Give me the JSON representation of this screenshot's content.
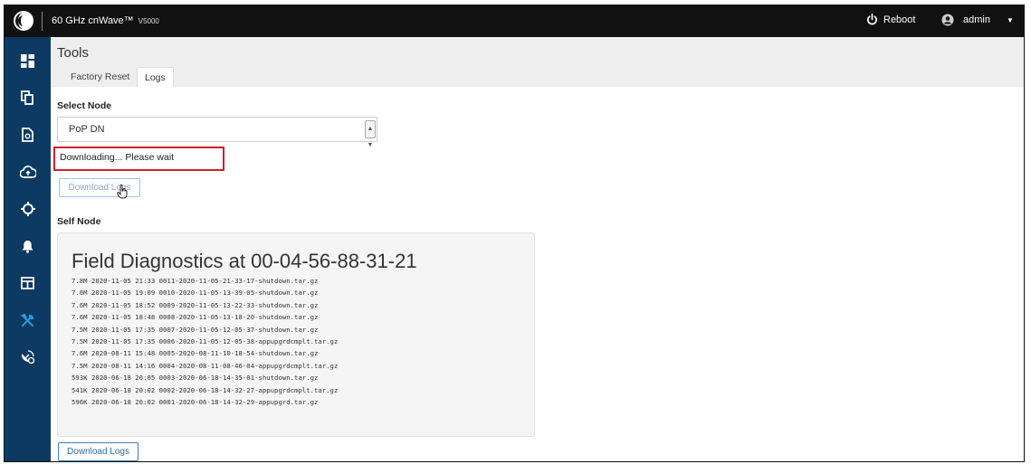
{
  "topbar": {
    "app_title": "60 GHz cnWave™",
    "model": "V5000",
    "reboot_label": "Reboot",
    "user_label": "admin",
    "icons": {
      "logo": "cambium-logo-icon",
      "reboot": "power-icon",
      "user": "user-circle-icon",
      "caret": "caret-down-icon"
    }
  },
  "sidebar": {
    "items": [
      {
        "icon": "dashboard-icon",
        "active": false
      },
      {
        "icon": "copy-icon",
        "active": false
      },
      {
        "icon": "document-gear-icon",
        "active": false
      },
      {
        "icon": "cloud-upload-icon",
        "active": false
      },
      {
        "icon": "crosshair-icon",
        "active": false
      },
      {
        "icon": "bell-icon",
        "active": false
      },
      {
        "icon": "layout-icon",
        "active": false
      },
      {
        "icon": "tools-icon",
        "active": true
      },
      {
        "icon": "satellite-dish-icon",
        "active": false
      }
    ],
    "active_color": "#2d9cdb",
    "icon_color": "#ffffff"
  },
  "page": {
    "title": "Tools",
    "tabs": [
      {
        "label": "Factory Reset",
        "active": false
      },
      {
        "label": "Logs",
        "active": true
      }
    ]
  },
  "logs": {
    "select_label": "Select Node",
    "selected_node": "PoP DN",
    "status_text": "Downloading... Please wait",
    "download_button_label": "Download Logs",
    "self_node_label": "Self Node",
    "diagnostics_title": "Field Diagnostics at 00-04-56-88-31-21",
    "files": [
      "7.8M 2020-11-05 21:33 0011-2020-11-05-21-33-17-shutdown.tar.gz",
      "7.6M 2020-11-05 19:09 0010-2020-11-05-13-39-05-shutdown.tar.gz",
      "7.6M 2020-11-05 18:52 0009-2020-11-05-13-22-33-shutdown.tar.gz",
      "7.6M 2020-11-05 18:48 0008-2020-11-05-13-18-20-shutdown.tar.gz",
      "7.5M 2020-11-05 17:35 0007-2020-11-05-12-05-37-shutdown.tar.gz",
      "7.5M 2020-11-05 17:35 0006-2020-11-05-12-05-38-appupgrdcmplt.tar.gz",
      "7.6M 2020-08-11 15:48 0005-2020-08-11-10-18-54-shutdown.tar.gz",
      "7.5M 2020-08-11 14:16 0004-2020-08-11-08-46-04-appupgrdcmplt.tar.gz",
      "593K 2020-06-18 20:05 0003-2020-06-18-14-35-01-shutdown.tar.gz",
      "541K 2020-06-18 20:02 0002-2020-06-18-14-32-27-appupgrdcmplt.tar.gz",
      "596K 2020-06-18 20:02 0001-2020-06-18-14-32-29-appupgrd.tar.gz"
    ]
  },
  "colors": {
    "topbar_bg": "#111111",
    "sidebar_bg": "#0d3a63",
    "status_border": "#d2202a",
    "button_border": "#3b7dc0"
  }
}
